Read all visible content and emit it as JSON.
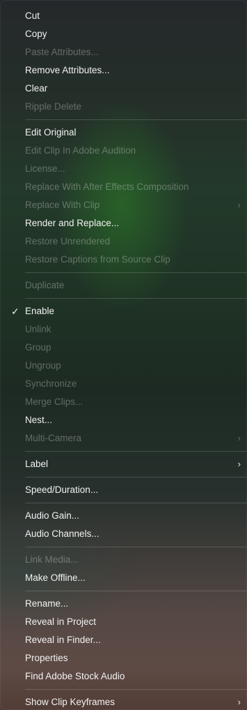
{
  "menu": {
    "groups": [
      [
        {
          "label": "Cut",
          "enabled": true
        },
        {
          "label": "Copy",
          "enabled": true
        },
        {
          "label": "Paste Attributes...",
          "enabled": false
        },
        {
          "label": "Remove Attributes...",
          "enabled": true
        },
        {
          "label": "Clear",
          "enabled": true
        },
        {
          "label": "Ripple Delete",
          "enabled": false
        }
      ],
      [
        {
          "label": "Edit Original",
          "enabled": true
        },
        {
          "label": "Edit Clip In Adobe Audition",
          "enabled": false
        },
        {
          "label": "License...",
          "enabled": false
        },
        {
          "label": "Replace With After Effects Composition",
          "enabled": false
        },
        {
          "label": "Replace With Clip",
          "enabled": false,
          "submenu": true
        },
        {
          "label": "Render and Replace...",
          "enabled": true
        },
        {
          "label": "Restore Unrendered",
          "enabled": false
        },
        {
          "label": "Restore Captions from Source Clip",
          "enabled": false
        }
      ],
      [
        {
          "label": "Duplicate",
          "enabled": false
        }
      ],
      [
        {
          "label": "Enable",
          "enabled": true,
          "checked": true
        },
        {
          "label": "Unlink",
          "enabled": false
        },
        {
          "label": "Group",
          "enabled": false
        },
        {
          "label": "Ungroup",
          "enabled": false
        },
        {
          "label": "Synchronize",
          "enabled": false
        },
        {
          "label": "Merge Clips...",
          "enabled": false
        },
        {
          "label": "Nest...",
          "enabled": true
        },
        {
          "label": "Multi-Camera",
          "enabled": false,
          "submenu": true
        }
      ],
      [
        {
          "label": "Label",
          "enabled": true,
          "submenu": true
        }
      ],
      [
        {
          "label": "Speed/Duration...",
          "enabled": true
        }
      ],
      [
        {
          "label": "Audio Gain...",
          "enabled": true
        },
        {
          "label": "Audio Channels...",
          "enabled": true
        }
      ],
      [
        {
          "label": "Link Media...",
          "enabled": false
        },
        {
          "label": "Make Offline...",
          "enabled": true
        }
      ],
      [
        {
          "label": "Rename...",
          "enabled": true
        },
        {
          "label": "Reveal in Project",
          "enabled": true
        },
        {
          "label": "Reveal in Finder...",
          "enabled": true
        },
        {
          "label": "Properties",
          "enabled": true
        },
        {
          "label": "Find Adobe Stock Audio",
          "enabled": true
        }
      ],
      [
        {
          "label": "Show Clip Keyframes",
          "enabled": true,
          "submenu": true
        }
      ]
    ],
    "check_glyph": "✓",
    "submenu_glyph": "›"
  }
}
